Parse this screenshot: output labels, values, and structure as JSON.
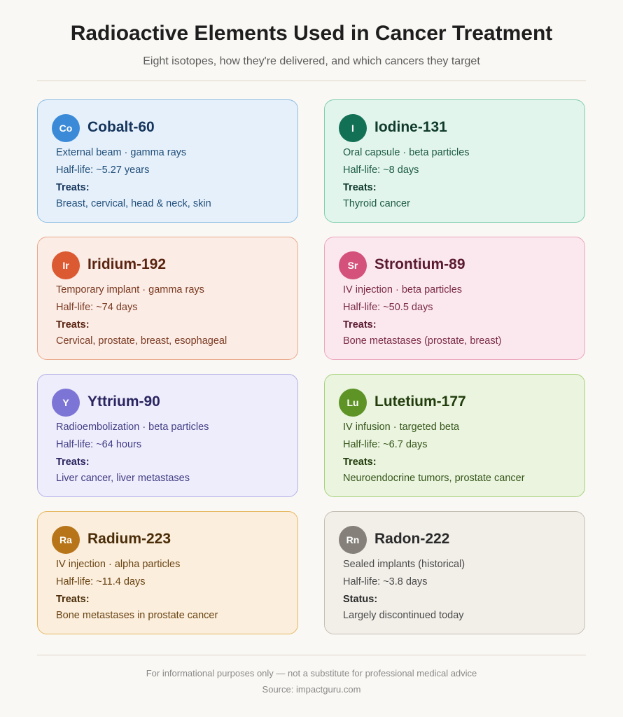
{
  "header": {
    "title": "Radioactive Elements Used in Cancer Treatment",
    "subtitle": "Eight isotopes, how they're delivered, and which cancers they target"
  },
  "cards": [
    {
      "symbol": "Co",
      "name": "Cobalt-60",
      "delivery": "External beam · gamma rays",
      "half_life": "Half-life: ~5.27 years",
      "label": "Treats:",
      "detail": "Breast, cervical, head & neck, skin",
      "colors": {
        "bg": "#e6f0fa",
        "border": "#8dbde3",
        "badge": "#3b8ad8",
        "title": "#15355c",
        "text": "#1f4e7a"
      }
    },
    {
      "symbol": "I",
      "name": "Iodine-131",
      "delivery": "Oral capsule · beta particles",
      "half_life": "Half-life: ~8 days",
      "label": "Treats:",
      "detail": "Thyroid cancer",
      "colors": {
        "bg": "#e2f5ec",
        "border": "#7fcdb0",
        "badge": "#127055",
        "title": "#0f3a2c",
        "text": "#1c5a44"
      }
    },
    {
      "symbol": "Ir",
      "name": "Iridium-192",
      "delivery": "Temporary implant · gamma rays",
      "half_life": "Half-life: ~74 days",
      "label": "Treats:",
      "detail": "Cervical, prostate, breast, esophageal",
      "colors": {
        "bg": "#fbece5",
        "border": "#eaa98c",
        "badge": "#db5a32",
        "title": "#5a2410",
        "text": "#7a3a22"
      }
    },
    {
      "symbol": "Sr",
      "name": "Strontium-89",
      "delivery": "IV injection · beta particles",
      "half_life": "Half-life: ~50.5 days",
      "label": "Treats:",
      "detail": "Bone metastases (prostate, breast)",
      "colors": {
        "bg": "#fbe8ee",
        "border": "#eba6bd",
        "badge": "#d4517c",
        "title": "#5a1a30",
        "text": "#7a2a46"
      }
    },
    {
      "symbol": "Y",
      "name": "Yttrium-90",
      "delivery": "Radioembolization · beta particles",
      "half_life": "Half-life: ~64 hours",
      "label": "Treats:",
      "detail": "Liver cancer, liver metastases",
      "colors": {
        "bg": "#eeedfb",
        "border": "#b3b0e6",
        "badge": "#7d75d6",
        "title": "#2a2560",
        "text": "#433e86"
      }
    },
    {
      "symbol": "Lu",
      "name": "Lutetium-177",
      "delivery": "IV infusion · targeted beta",
      "half_life": "Half-life: ~6.7 days",
      "label": "Treats:",
      "detail": "Neuroendocrine tumors, prostate cancer",
      "colors": {
        "bg": "#eaf4df",
        "border": "#a6d27b",
        "badge": "#5e9326",
        "title": "#223d0c",
        "text": "#36561a"
      }
    },
    {
      "symbol": "Ra",
      "name": "Radium-223",
      "delivery": "IV injection · alpha particles",
      "half_life": "Half-life: ~11.4 days",
      "label": "Treats:",
      "detail": "Bone metastases in prostate cancer",
      "colors": {
        "bg": "#fbeedc",
        "border": "#e6b863",
        "badge": "#b87418",
        "title": "#4a2c08",
        "text": "#6a4414"
      }
    },
    {
      "symbol": "Rn",
      "name": "Radon-222",
      "delivery": "Sealed implants (historical)",
      "half_life": "Half-life: ~3.8 days",
      "label": "Status:",
      "detail": "Largely discontinued today",
      "colors": {
        "bg": "#f2efe9",
        "border": "#c4beb4",
        "badge": "#85817a",
        "title": "#2a2a2a",
        "text": "#4a4a4a"
      }
    }
  ],
  "footer": {
    "note": "For informational purposes only — not a substitute for professional medical advice",
    "source": "Source: impactguru.com"
  }
}
